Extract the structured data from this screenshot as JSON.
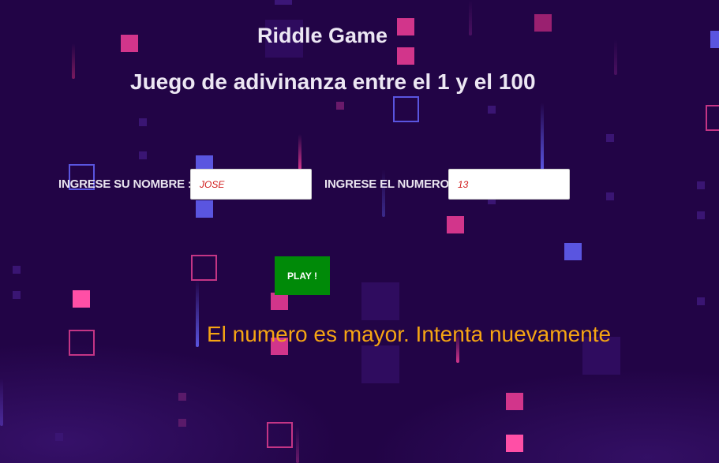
{
  "game": {
    "title": "Riddle Game",
    "subtitle": "Juego de adivinanza entre el 1 y el 100"
  },
  "form": {
    "name_label": "INGRESE SU NOMBRE :",
    "name_value": "JOSE",
    "number_label": "INGRESE EL NUMERO",
    "number_value": "13",
    "play_label": "PLAY !"
  },
  "result": {
    "message": "El numero es mayor. Intenta nuevamente"
  },
  "colors": {
    "background": "#220446",
    "pink": "#d2358b",
    "hot_pink": "#ff4fa6",
    "blue": "#5a55e0",
    "play_button": "#008a08",
    "message": "#f6a513",
    "input_text": "#d11a1a"
  }
}
